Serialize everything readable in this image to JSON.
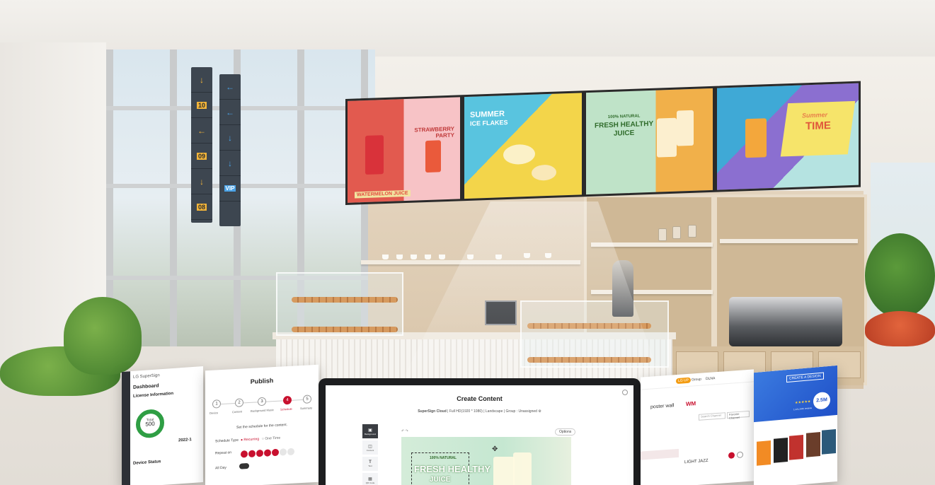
{
  "scene": {
    "description_colors": {
      "accent": "#c8102e",
      "lg_green": "#2f9e44",
      "panel_yellow": "#f3d54a"
    }
  },
  "signage": {
    "gates": [
      "10",
      "09",
      "08"
    ],
    "tags": [
      "VIP"
    ]
  },
  "video_wall": {
    "panels": [
      {
        "texts": [
          "STRAWBERRY",
          "PARTY",
          "WATERMELON JUICE"
        ]
      },
      {
        "texts": [
          "SUMMER",
          "ICE FLAKES"
        ]
      },
      {
        "texts": [
          "100% NATURAL",
          "FRESH HEALTHY",
          "JUICE"
        ]
      },
      {
        "texts": [
          "Summer",
          "TIME"
        ]
      }
    ]
  },
  "dashboard_card": {
    "logo": "LG SuperSign",
    "title": "Dashboard",
    "section1": "License Information",
    "gauge_top": "Total",
    "gauge_value": "500",
    "date": "2022-1",
    "section2": "Device Status"
  },
  "publish_card": {
    "title": "Publish",
    "steps": [
      "Device",
      "Content",
      "Background Music",
      "Schedule",
      "Summary"
    ],
    "active_step": 4,
    "instruction": "Set the schedule for the content.",
    "schedule_type_label": "Schedule Type",
    "options": [
      "Recurring",
      "One Time"
    ],
    "repeat_label": "Repeat on",
    "all_day_label": "All Day"
  },
  "create_content": {
    "title": "Create Content",
    "meta": [
      "SuperSign Cloud",
      "Full HD(1920 * 1080)",
      "Landscape",
      "Group : Unassigned"
    ],
    "tools": [
      "Background",
      "Content",
      "Text",
      "QR Code"
    ],
    "options_button": "Options",
    "preview_texts": [
      "100% NATURAL",
      "FRESH HEALTHY",
      "JUICE"
    ]
  },
  "music_card": {
    "tabs": [
      "LG UP",
      "Group",
      "DLNA"
    ],
    "heading": "poster wall",
    "brand": "WM",
    "search_placeholder": "Search Channel",
    "favorite": "Favorite Channel",
    "track": "LIGHT JAZZ"
  },
  "design_card": {
    "button": "CREATE A DESIGN",
    "badge": "2.5M",
    "reviews": "1,121,3445 reviews"
  }
}
